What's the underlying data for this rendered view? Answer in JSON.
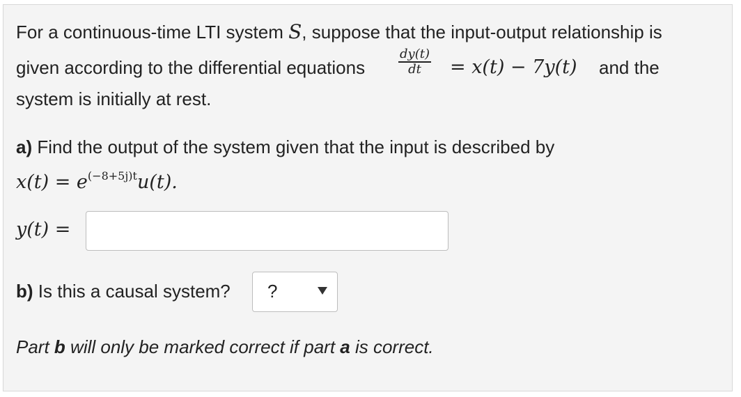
{
  "question": {
    "intro_pre": "For a continuous-time LTI system ",
    "system_symbol": "S",
    "intro_post": ", suppose that the input-output relationship is",
    "line2_pre": "given according to the differential equations",
    "frac_num": "dy(t)",
    "frac_den": "dt",
    "eq_rest": "= x(t) − 7y(t)",
    "line2_post": "and the",
    "line3": "system is initially at rest."
  },
  "part_a": {
    "label": "a)",
    "text": " Find the output of the system given that the input is described by",
    "input_base": "x(t) = e",
    "input_exp": "(−8+5j)t",
    "input_tail": "u(t).",
    "answer_label": "y(t) =",
    "answer_value": ""
  },
  "part_b": {
    "label": "b)",
    "text": " Is this a causal system?",
    "select_value": "?"
  },
  "note": {
    "pre": "Part ",
    "b": "b",
    "mid": " will only be marked correct if part ",
    "a": "a",
    "post": " is correct."
  }
}
